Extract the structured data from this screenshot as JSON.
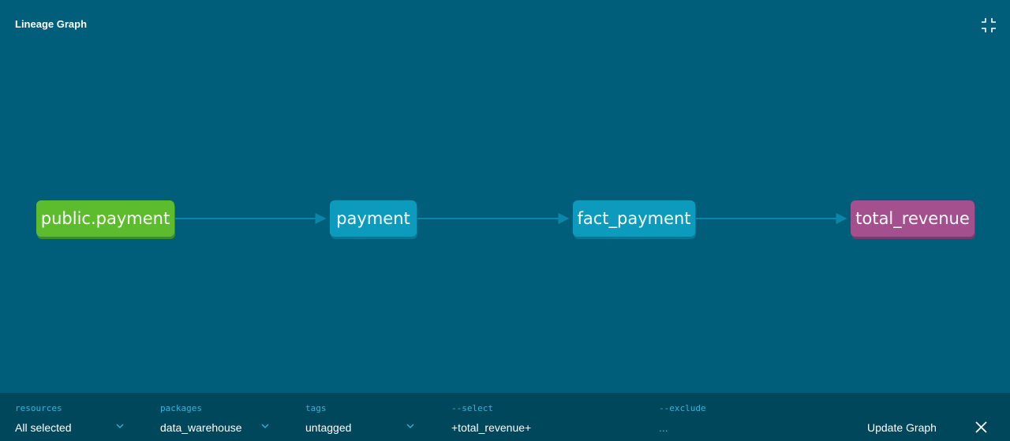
{
  "header": {
    "title": "Lineage Graph",
    "collapse_icon": "collapse-icon"
  },
  "graph": {
    "nodes": [
      {
        "id": "public.payment",
        "label": "public.payment",
        "type": "source",
        "color": "#5dbb2e"
      },
      {
        "id": "payment",
        "label": "payment",
        "type": "model",
        "color": "#0d9bbd"
      },
      {
        "id": "fact_payment",
        "label": "fact_payment",
        "type": "model",
        "color": "#0d9bbd"
      },
      {
        "id": "total_revenue",
        "label": "total_revenue",
        "type": "exposure",
        "color": "#a4508e"
      }
    ],
    "edges": [
      {
        "from": "public.payment",
        "to": "payment"
      },
      {
        "from": "payment",
        "to": "fact_payment"
      },
      {
        "from": "fact_payment",
        "to": "total_revenue"
      }
    ]
  },
  "filters": {
    "resources": {
      "label": "resources",
      "value": "All selected"
    },
    "packages": {
      "label": "packages",
      "value": "data_warehouse"
    },
    "tags": {
      "label": "tags",
      "value": "untagged"
    },
    "select": {
      "label": "--select",
      "value": "+total_revenue+"
    },
    "exclude": {
      "label": "--exclude",
      "value": "..."
    }
  },
  "actions": {
    "update_label": "Update Graph",
    "close_icon": "close-icon"
  },
  "colors": {
    "background": "#005e7a",
    "filter_bar": "#00475c",
    "label_accent": "#2fb6da"
  }
}
